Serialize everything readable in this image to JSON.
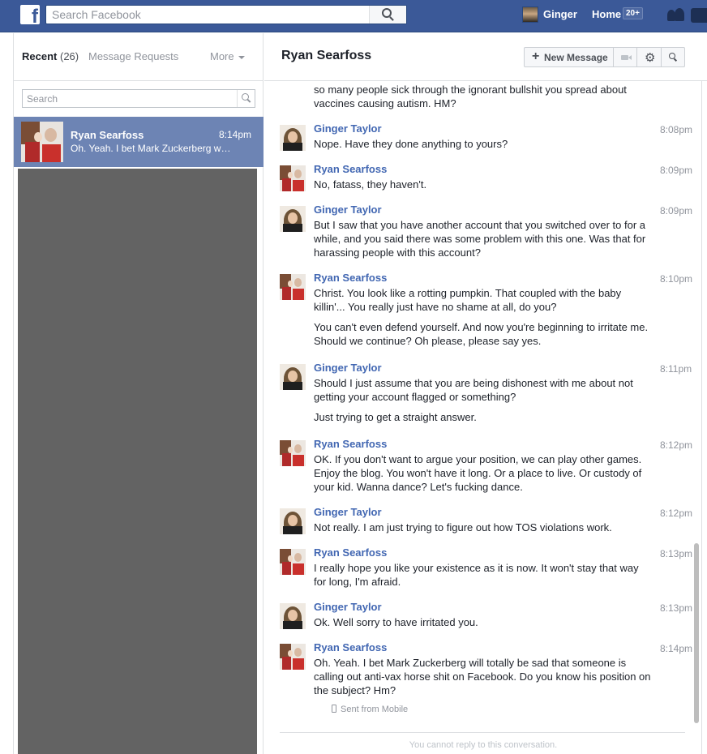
{
  "topbar": {
    "search_placeholder": "Search Facebook",
    "user_name": "Ginger",
    "home_label": "Home",
    "home_badge": "20+"
  },
  "sidebar": {
    "tab_recent": "Recent",
    "tab_recent_count": "(26)",
    "tab_requests": "Message Requests",
    "tab_more": "More",
    "search_placeholder": "Search",
    "threads": [
      {
        "name": "Ryan Searfoss",
        "time": "8:14pm",
        "snippet": "Oh. Yeah. I bet Mark Zuckerberg will totally be sad that someone is calling out anti-vax horse shit on Facebook."
      }
    ]
  },
  "conversation": {
    "title": "Ryan Searfoss",
    "new_message_label": "New Message",
    "gear_icon": "gear-icon",
    "top_fragment": [
      "so many people sick through the ignorant bullshit you spread about",
      "vaccines causing autism. HM?"
    ],
    "messages": [
      {
        "sender": "Ginger Taylor",
        "time": "8:08pm",
        "avatar": "ginger",
        "paragraphs": [
          [
            "Nope.  Have they done anything to yours?"
          ]
        ]
      },
      {
        "sender": "Ryan Searfoss",
        "time": "8:09pm",
        "avatar": "ryan",
        "paragraphs": [
          [
            "No, fatass, they haven't."
          ]
        ]
      },
      {
        "sender": "Ginger Taylor",
        "time": "8:09pm",
        "avatar": "ginger",
        "paragraphs": [
          [
            "But I saw that you have another account that you switched over to for a",
            "while, and you said there was some problem with this one.  Was that for",
            "harassing people with this account?"
          ]
        ]
      },
      {
        "sender": "Ryan Searfoss",
        "time": "8:10pm",
        "avatar": "ryan",
        "paragraphs": [
          [
            "Christ. You look like a rotting pumpkin. That coupled with the baby",
            "killin'... You really just have no shame at all, do you?"
          ],
          [
            "You can't even defend yourself. And now you're beginning to irritate me.",
            "Should we continue? Oh please, please say yes."
          ]
        ]
      },
      {
        "sender": "Ginger Taylor",
        "time": "8:11pm",
        "avatar": "ginger",
        "paragraphs": [
          [
            "Should I just assume that you are being dishonest with me about not",
            "getting your account flagged or something?"
          ],
          [
            "Just trying to get a straight answer."
          ]
        ]
      },
      {
        "sender": "Ryan Searfoss",
        "time": "8:12pm",
        "avatar": "ryan",
        "paragraphs": [
          [
            "OK. If you don't want to argue your position, we can play other games.",
            "Enjoy the blog. You won't have it long. Or a place to live. Or custody of",
            "your kid. Wanna dance? Let's fucking dance."
          ]
        ]
      },
      {
        "sender": "Ginger Taylor",
        "time": "8:12pm",
        "avatar": "ginger",
        "paragraphs": [
          [
            "Not really.  I am just trying to figure out how TOS violations work."
          ]
        ]
      },
      {
        "sender": "Ryan Searfoss",
        "time": "8:13pm",
        "avatar": "ryan",
        "paragraphs": [
          [
            "I really hope you like your existence as it is now. It won't stay that way",
            "for long, I'm afraid."
          ]
        ]
      },
      {
        "sender": "Ginger Taylor",
        "time": "8:13pm",
        "avatar": "ginger",
        "paragraphs": [
          [
            "Ok.  Well sorry to have irritated you."
          ]
        ]
      },
      {
        "sender": "Ryan Searfoss",
        "time": "8:14pm",
        "avatar": "ryan",
        "paragraphs": [
          [
            "Oh. Yeah. I bet Mark Zuckerberg will totally be sad that someone is",
            "calling out anti-vax horse shit on Facebook. Do you know his position on",
            "the subject? Hm?"
          ]
        ]
      }
    ],
    "sent_from": "Sent from Mobile",
    "cannot_reply": "You cannot reply to this conversation."
  },
  "colors": {
    "topbar": "#3b5998",
    "selected_thread": "#6d84b4",
    "sender_name": "#4267b2"
  }
}
